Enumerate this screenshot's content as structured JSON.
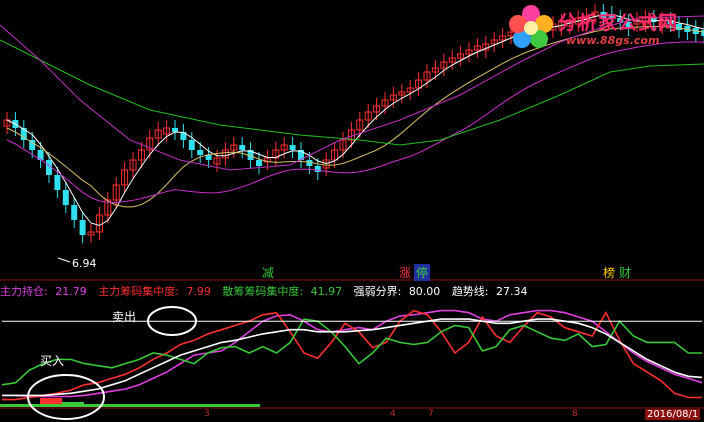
{
  "watermark": {
    "title": "分析家公式网",
    "url": "www.88gs.com"
  },
  "upper_panel": {
    "low_label": "6.94",
    "signal_tags": [
      {
        "text": "减",
        "color": "#38c838"
      },
      {
        "text": "涨",
        "color": "#ff3030"
      },
      {
        "text": "停",
        "color": "#38c838"
      },
      {
        "text": "榜",
        "color": "#ffcc00"
      },
      {
        "text": "财",
        "color": "#38c838"
      }
    ]
  },
  "indicator": {
    "legend": [
      {
        "label": "主力持仓: ",
        "value": "21.79",
        "color": "#e040e0"
      },
      {
        "label": "主力筹码集中度: ",
        "value": "7.99",
        "color": "#ff3030"
      },
      {
        "label": "散筹筹码集中度: ",
        "value": "41.97",
        "color": "#38c838"
      },
      {
        "label": "强弱分界: ",
        "value": "80.00",
        "color": "#ffffff"
      },
      {
        "label": "趋势线: ",
        "value": "27.34",
        "color": "#ffffff"
      }
    ],
    "annotations": {
      "buy": "买入",
      "sell": "卖出"
    },
    "threshold": 80,
    "date_label": "2016/08/1",
    "ticks": [
      "3",
      "4",
      "7",
      "8"
    ]
  },
  "colors": {
    "up": "#ff3030",
    "down": "#30e0f0",
    "ma_white": "#ffffff",
    "ma_magenta": "#d030d0",
    "ma_green": "#20c020"
  },
  "chart_data": {
    "type": "line",
    "title": "",
    "series": [
      {
        "name": "主力持仓",
        "values": [
          10,
          10,
          9,
          9,
          9,
          9,
          10,
          12,
          14,
          16,
          20,
          26,
          32,
          40,
          48,
          50,
          52,
          60,
          70,
          80,
          85,
          86,
          80,
          72,
          70,
          72,
          74,
          72,
          80,
          85,
          86,
          88,
          90,
          90,
          88,
          82,
          80,
          86,
          88,
          90,
          90,
          88,
          84,
          80,
          70,
          60,
          50,
          42,
          36,
          30,
          26,
          22
        ]
      },
      {
        "name": "主力筹码集中度",
        "values": [
          6,
          6,
          8,
          10,
          12,
          15,
          20,
          22,
          26,
          30,
          36,
          44,
          50,
          58,
          62,
          68,
          72,
          76,
          80,
          86,
          88,
          70,
          50,
          45,
          60,
          78,
          70,
          55,
          60,
          80,
          90,
          86,
          70,
          50,
          60,
          84,
          66,
          60,
          75,
          88,
          84,
          74,
          70,
          66,
          88,
          62,
          40,
          32,
          24,
          12,
          8,
          8
        ]
      },
      {
        "name": "散筹筹码集中度",
        "values": [
          20,
          22,
          34,
          40,
          44,
          44,
          40,
          38,
          36,
          40,
          44,
          50,
          48,
          44,
          40,
          50,
          55,
          56,
          50,
          56,
          50,
          60,
          82,
          80,
          70,
          56,
          40,
          50,
          64,
          60,
          58,
          60,
          70,
          76,
          74,
          52,
          56,
          72,
          76,
          70,
          64,
          62,
          68,
          56,
          58,
          80,
          66,
          60,
          60,
          60,
          50,
          50
        ]
      },
      {
        "name": "强弱分界",
        "values": [
          80,
          80,
          80,
          80,
          80,
          80,
          80,
          80,
          80,
          80,
          80,
          80,
          80,
          80,
          80,
          80,
          80,
          80,
          80,
          80,
          80,
          80,
          80,
          80,
          80,
          80,
          80,
          80,
          80,
          80,
          80,
          80,
          80,
          80,
          80,
          80,
          80,
          80,
          80,
          80,
          80,
          80,
          80,
          80,
          80,
          80,
          80,
          80,
          80,
          80,
          80,
          80
        ]
      },
      {
        "name": "趋势线",
        "values": [
          10,
          10,
          10,
          10,
          11,
          12,
          14,
          16,
          20,
          24,
          30,
          36,
          42,
          48,
          52,
          56,
          60,
          62,
          65,
          68,
          70,
          72,
          72,
          70,
          70,
          70,
          71,
          72,
          74,
          76,
          78,
          80,
          82,
          82,
          82,
          80,
          78,
          78,
          80,
          82,
          82,
          80,
          78,
          74,
          68,
          60,
          52,
          44,
          38,
          32,
          28,
          27
        ]
      }
    ]
  }
}
